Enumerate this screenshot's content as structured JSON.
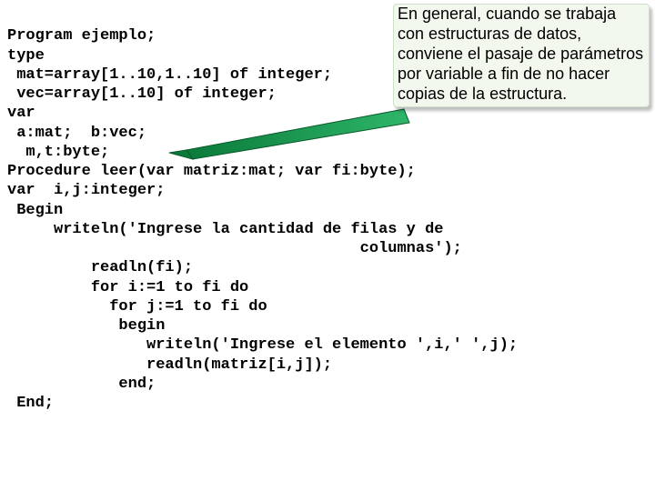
{
  "code": {
    "l1": "Program ejemplo;",
    "l2": "type",
    "l3": " mat=array[1..10,1..10] of integer;",
    "l4": " vec=array[1..10] of integer;",
    "l5": "var",
    "l6": " a:mat;  b:vec;",
    "l7": "  m,t:byte;",
    "l8": "Procedure leer(var matriz:mat; var fi:byte);",
    "l9": "var  i,j:integer;",
    "l10": " Begin",
    "l11": "     writeln('Ingrese la cantidad de filas y de",
    "l12": "                                      columnas');",
    "l13": "         readln(fi);",
    "l14": "         for i:=1 to fi do",
    "l15": "           for j:=1 to fi do",
    "l16": "            begin",
    "l17": "               writeln('Ingrese el elemento ',i,' ',j);",
    "l18": "               readln(matriz[i,j]);",
    "l19": "            end;",
    "l20": " End;"
  },
  "callout": {
    "text": "En general, cuando se trabaja con  estructuras de datos, conviene el pasaje de parámetros por variable a fin de no hacer copias de la estructura."
  }
}
